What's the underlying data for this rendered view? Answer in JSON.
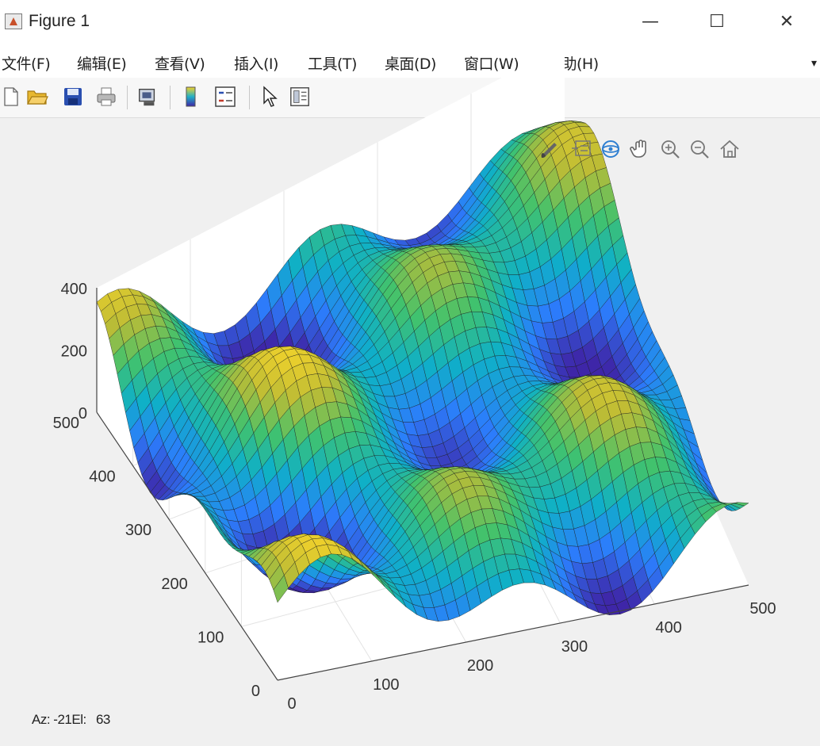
{
  "window": {
    "title": "Figure 1",
    "controls": {
      "minimize": "—",
      "maximize": "☐",
      "close": "✕"
    }
  },
  "menu": {
    "items": [
      "文件(F)",
      "编辑(E)",
      "查看(V)",
      "插入(I)",
      "工具(T)",
      "桌面(D)",
      "窗口(W)",
      "帮助(H)"
    ],
    "overflow": "▾"
  },
  "toolbar": {
    "icons": [
      "new-figure-icon",
      "open-icon",
      "save-icon",
      "print-icon",
      "link-plot-icon",
      "colorbar-icon",
      "legend-icon",
      "edit-plot-icon",
      "property-inspector-icon"
    ]
  },
  "axes_toolbar": {
    "icons": [
      "brush-icon",
      "data-tips-icon",
      "rotate-3d-icon",
      "pan-icon",
      "zoom-in-icon",
      "zoom-out-icon",
      "home-icon"
    ],
    "active": "rotate-3d-icon",
    "active_color": "#2f7fd1"
  },
  "chart_data": {
    "type": "surface",
    "x_ticks": [
      "0",
      "100",
      "200",
      "300",
      "400",
      "500"
    ],
    "y_ticks": [
      "0",
      "100",
      "200",
      "300",
      "400",
      "500"
    ],
    "z_ticks": [
      "0",
      "200",
      "400"
    ],
    "xlim": [
      0,
      500
    ],
    "ylim": [
      0,
      500
    ],
    "zlim": [
      0,
      400
    ],
    "view": {
      "azimuth": -21,
      "elevation": 63
    },
    "colormap": "parula",
    "colors": [
      "#3e26a8",
      "#2c7dfc",
      "#0fb0c7",
      "#41c26d",
      "#bdbc35",
      "#f9d52a"
    ]
  },
  "status": {
    "az_label": "Az:",
    "az_value": "-21",
    "el_label": "El:",
    "el_value": "63"
  }
}
